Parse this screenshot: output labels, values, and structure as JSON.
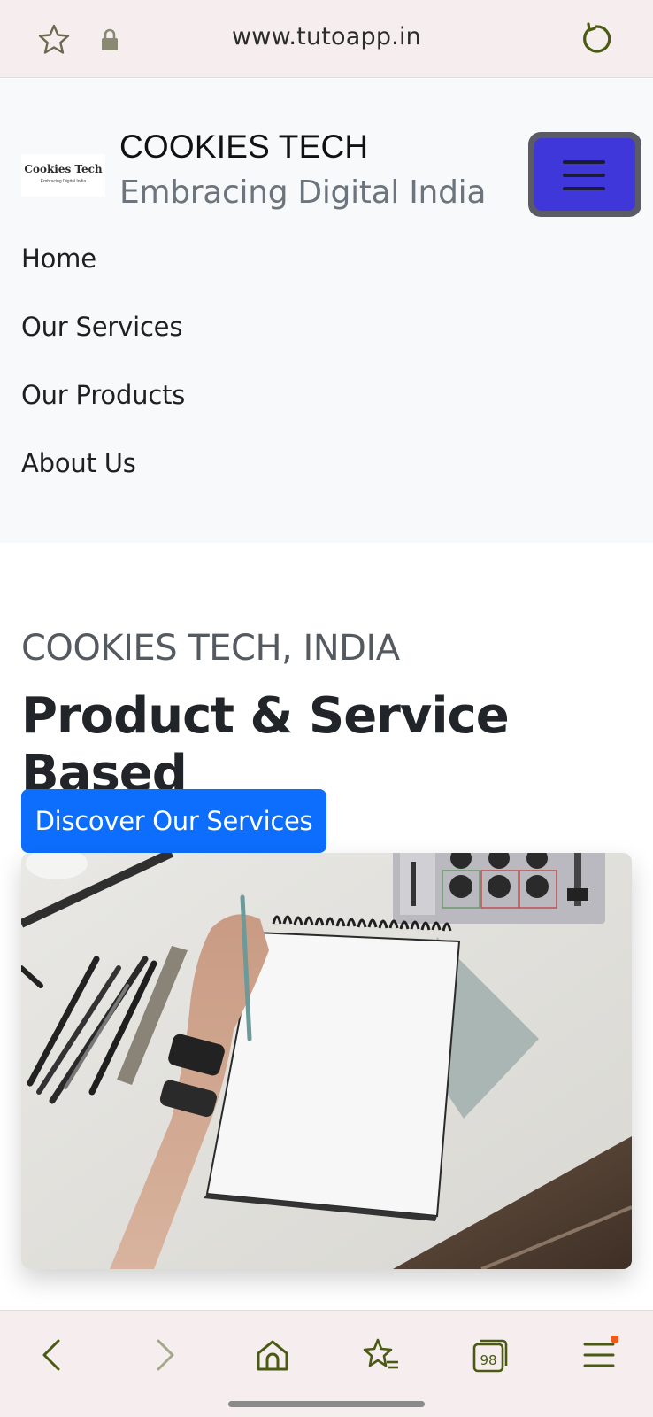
{
  "browser": {
    "url": "www.tutoapp.in",
    "tab_count": "98",
    "icons": [
      "star-icon",
      "lock-icon",
      "reload-icon",
      "back-icon",
      "forward-icon",
      "home-icon",
      "bookmarks-icon",
      "tabs-icon",
      "menu-icon"
    ],
    "accent_color": "#4a5a12",
    "notification_dot_color": "#f25a1c"
  },
  "header": {
    "logo_text": "Cookies Tech",
    "logo_subtext": "Embracing Digital India",
    "brand_name": "COOKIES TECH",
    "tagline": "Embracing Digital India",
    "toggler_color": "#3f37d9"
  },
  "nav": {
    "items": [
      {
        "label": "Home"
      },
      {
        "label": "Our Services"
      },
      {
        "label": "Our Products"
      },
      {
        "label": "About Us"
      }
    ]
  },
  "hero": {
    "eyebrow": "COOKIES TECH, INDIA",
    "title": "Product & Service Based",
    "cta_label": "Discover Our Services",
    "cta_color": "#0d6efd"
  }
}
